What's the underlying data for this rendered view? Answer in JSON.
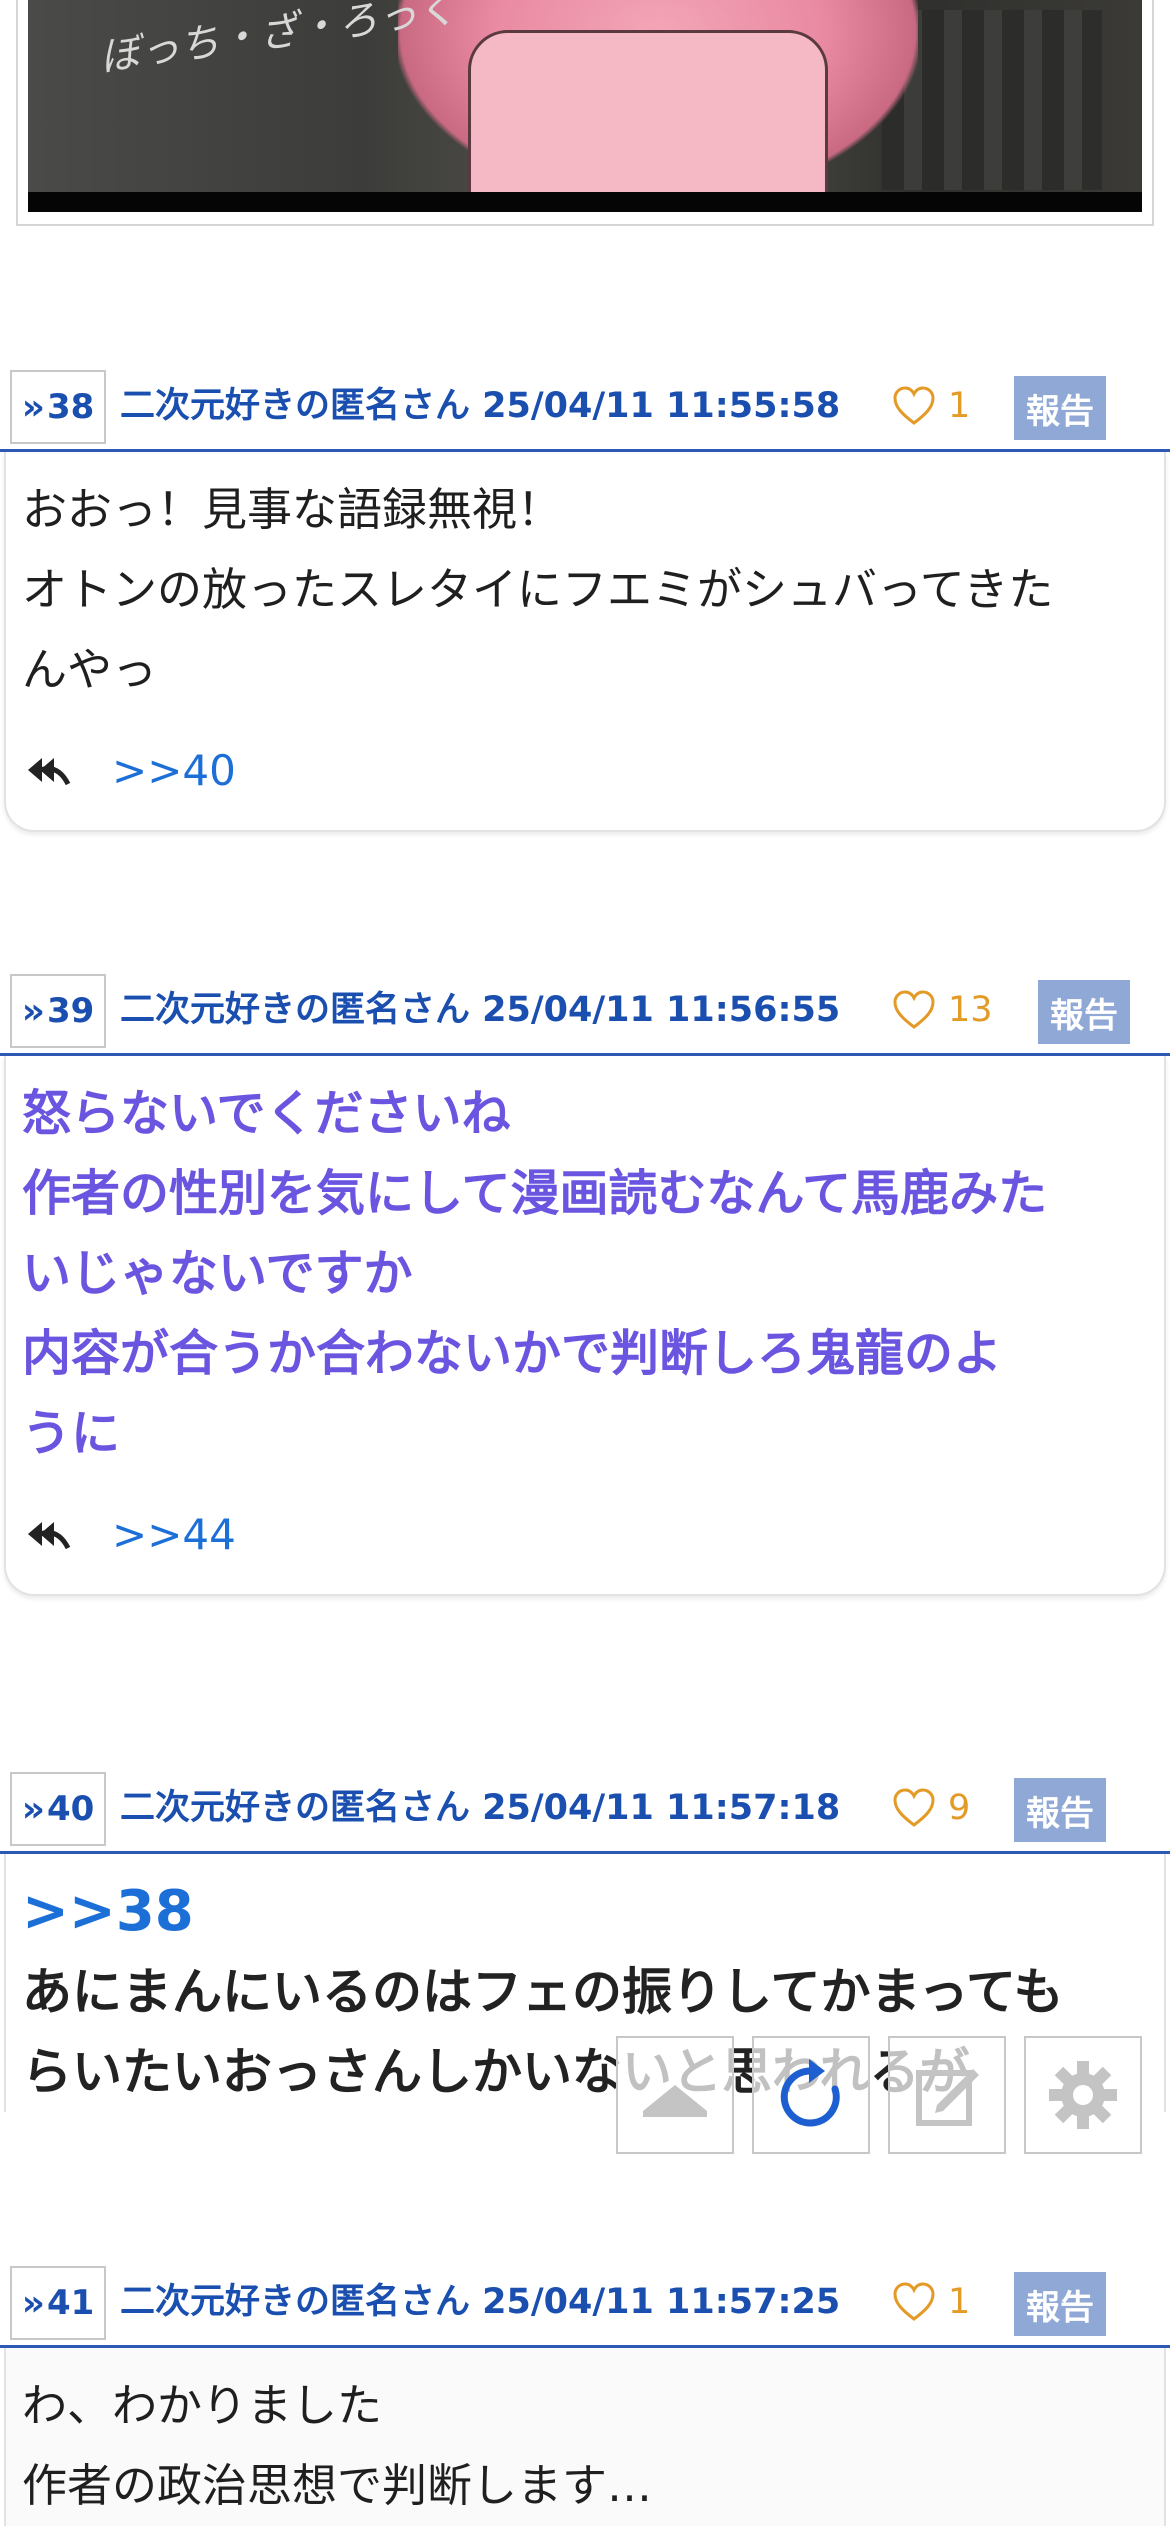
{
  "top_image": {
    "scribble_text": "ぼっち・ざ・ろっく"
  },
  "posts": [
    {
      "num": "38",
      "name_date": "二次元好きの匿名さん 25/04/11 11:55:58",
      "likes": "1",
      "report": "報告",
      "style": "normal",
      "lines": [
        "おおっ！見事な語録無視！",
        "オトンの放ったスレタイにフエミがシュバってきた",
        "んやっ"
      ],
      "reply": ">>40"
    },
    {
      "num": "39",
      "name_date": "二次元好きの匿名さん 25/04/11 11:56:55",
      "likes": "13",
      "report": "報告",
      "style": "purple",
      "lines": [
        "怒らないでくださいね",
        "作者の性別を気にして漫画読むなんて馬鹿みた",
        "いじゃないですか",
        "内容が合うか合わないかで判断しろ鬼龍のよ",
        "うに"
      ],
      "reply": ">>44"
    },
    {
      "num": "40",
      "name_date": "二次元好きの匿名さん 25/04/11 11:57:18",
      "likes": "9",
      "report": "報告",
      "style": "bold",
      "anchor": ">>38",
      "lines": [
        "あにまんにいるのはフェの振りしてかまっても",
        "らいたいおっさんしかいないと思われるが"
      ]
    },
    {
      "num": "41",
      "name_date": "二次元好きの匿名さん 25/04/11 11:57:25",
      "likes": "1",
      "report": "報告",
      "style": "normal",
      "lines": [
        "わ、わかりました",
        "作者の政治思想で判断します…"
      ]
    }
  ],
  "toolbar": {
    "buttons": [
      "up-arrow-icon",
      "refresh-icon",
      "compose-icon",
      "gear-icon"
    ],
    "accent": "#1d5fd0"
  },
  "colors": {
    "link_blue": "#1a4fb0",
    "like_orange": "#e39a26",
    "report_bg": "#8fa8d6",
    "purple_text": "#6a55e0"
  }
}
